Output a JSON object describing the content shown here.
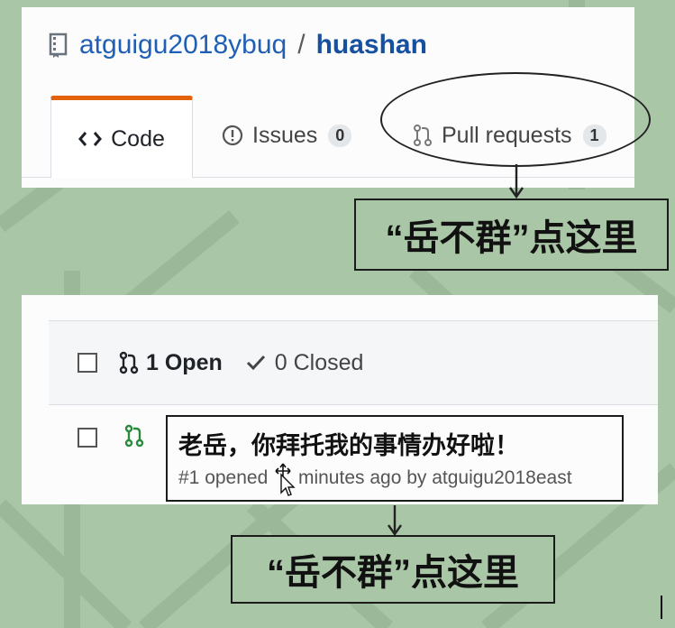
{
  "repo": {
    "owner": "atguigu2018ybuq",
    "separator": "/",
    "name": "huashan"
  },
  "tabs": [
    {
      "label": "Code",
      "icon": "code-icon"
    },
    {
      "label": "Issues",
      "count": "0",
      "icon": "issue-opened-icon"
    },
    {
      "label": "Pull requests",
      "count": "1",
      "icon": "git-pull-request-icon"
    }
  ],
  "annotations": {
    "top_callout": "“岳不群”点这里",
    "bottom_callout": "“岳不群”点这里"
  },
  "pull_requests": {
    "open_label": "1 Open",
    "closed_label": "0 Closed",
    "items": [
      {
        "title": "老岳，你拜托我的事情办好啦！",
        "meta_prefix": "#1 opened",
        "meta_suffix": "minutes ago by atguigu2018east"
      }
    ]
  },
  "colors": {
    "link": "#1f5fb5",
    "accent_tab": "#e36209",
    "open_pr": "#2a8a3e",
    "background": "#a9c6a6"
  }
}
